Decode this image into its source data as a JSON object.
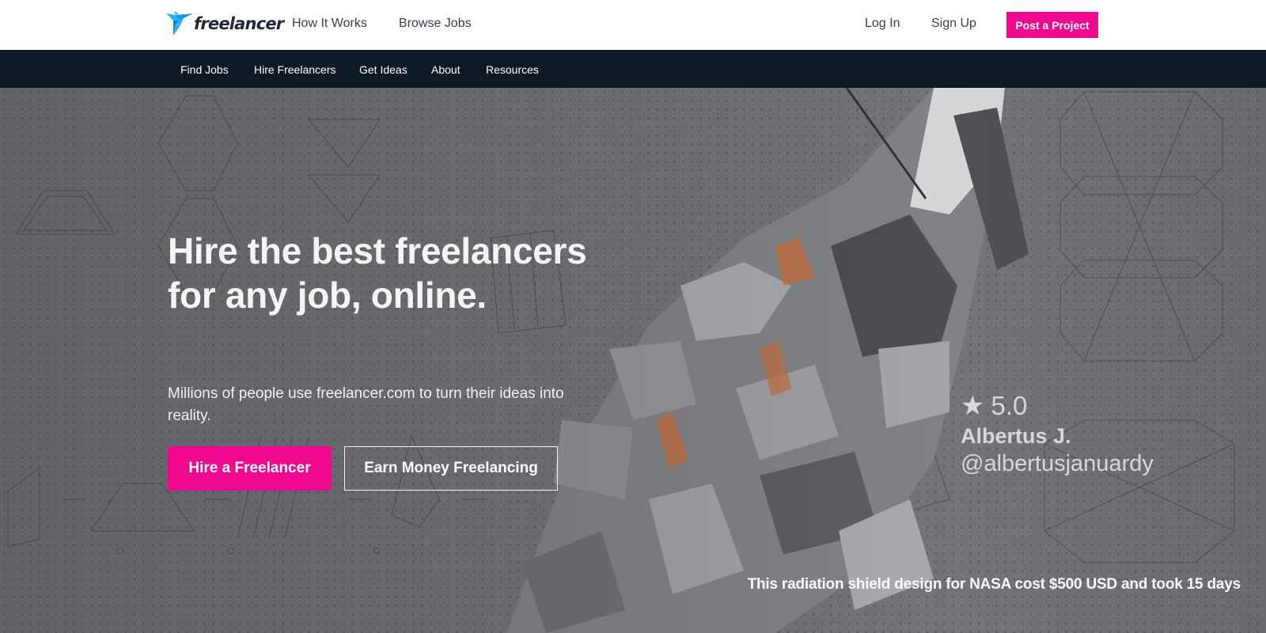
{
  "header": {
    "brand": "freelancer",
    "nav_links": [
      "How It Works",
      "Browse Jobs"
    ],
    "login_label": "Log In",
    "signup_label": "Sign Up",
    "post_project_label": "Post a Project"
  },
  "subnav": {
    "items": [
      "Find Jobs",
      "Hire Freelancers",
      "Get Ideas",
      "About",
      "Resources"
    ]
  },
  "hero": {
    "headline": "Hire the best freelancers for any job, online.",
    "subtext": "Millions of people use freelancer.com to turn their ideas into reality.",
    "primary_cta": "Hire a Freelancer",
    "secondary_cta": "Earn Money Freelancing",
    "review": {
      "icon": "star-icon",
      "rating": "5.0",
      "name": "Albertus J.",
      "handle": "@albertusjanuardy"
    },
    "caption": "This radiation shield design for NASA cost $500 USD and took 15 days"
  },
  "colors": {
    "brand_accent": "#f0088f",
    "logo_blue": "#29b2fe",
    "subnav_bg": "#0f1825",
    "header_bg": "#ffffff"
  }
}
